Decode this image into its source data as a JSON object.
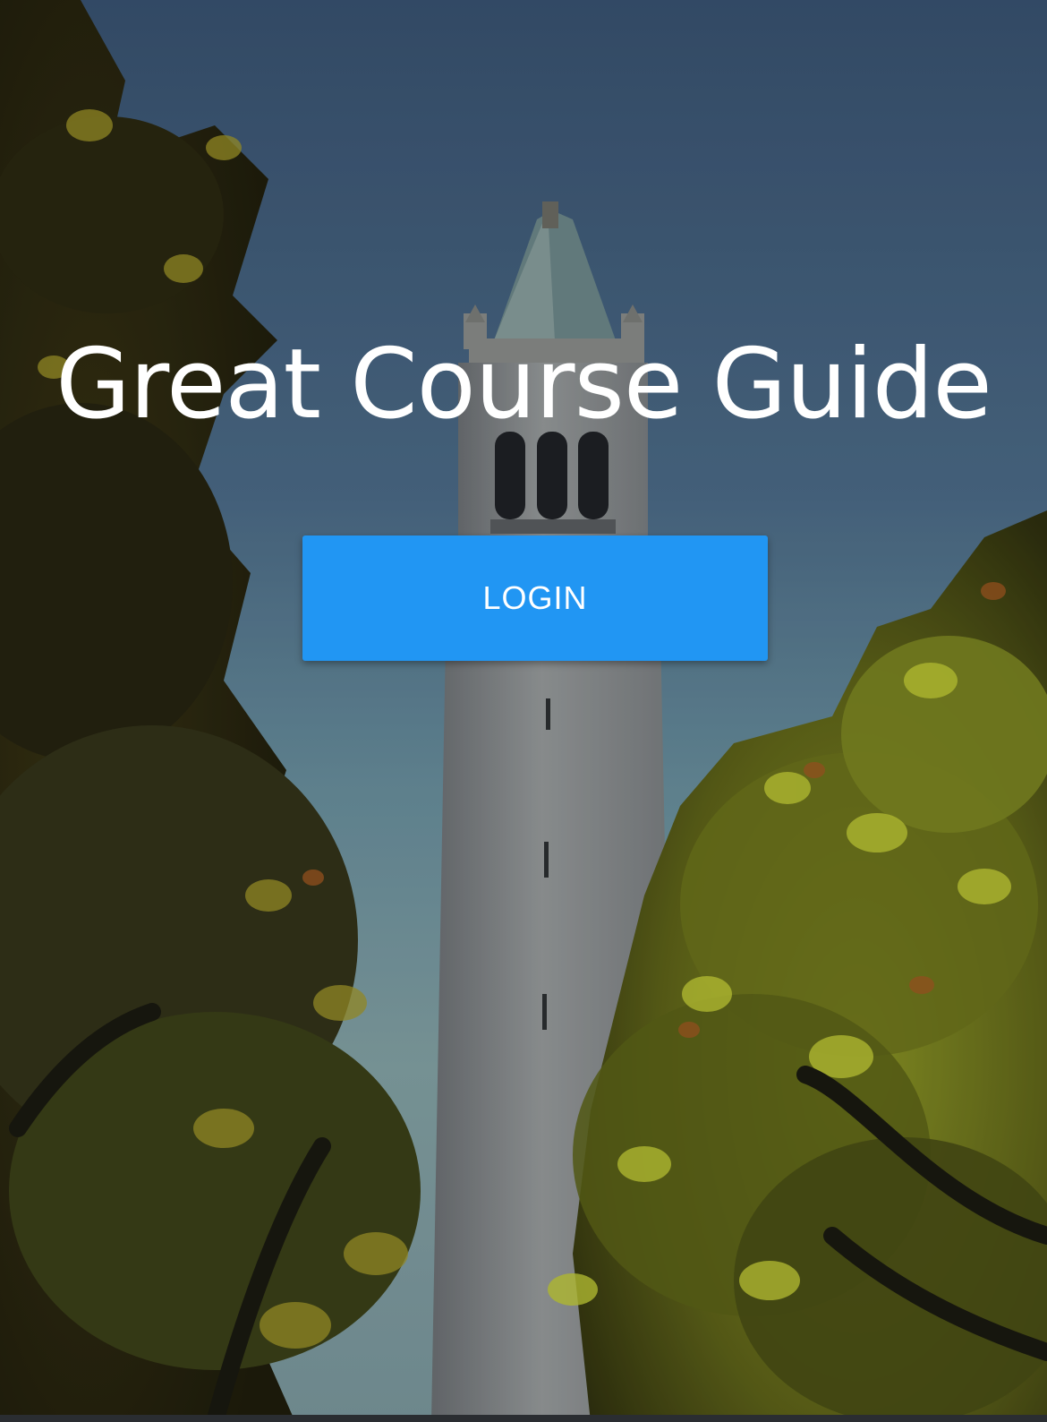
{
  "hero": {
    "title": "Great Course Guide",
    "login_label": "LOGIN"
  },
  "colors": {
    "button": "#2196f3",
    "title_text": "#ffffff",
    "sky_top": "#3b5676",
    "sky_bottom": "#6e8f9a",
    "foliage_dark": "#2a2a12",
    "foliage_light": "#9aa52a"
  }
}
